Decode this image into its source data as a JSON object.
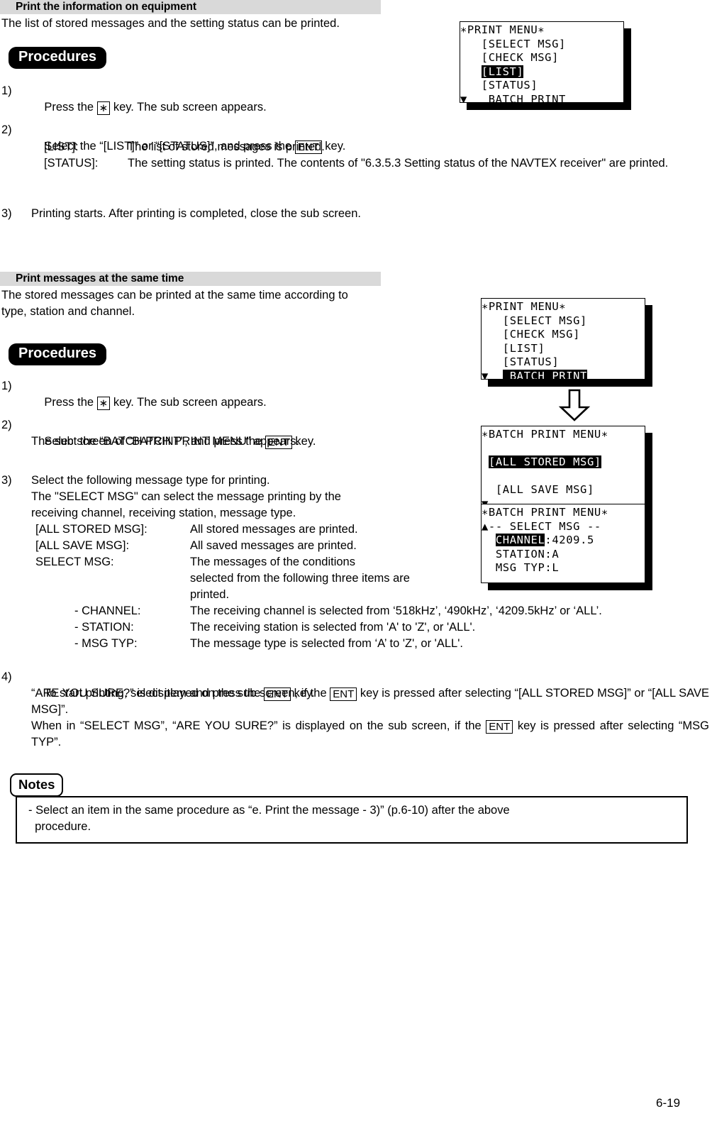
{
  "page": {
    "number": "6-19"
  },
  "sections": [
    {
      "header": "Print the information on equipment",
      "intro": "The list of stored messages and the setting status can be printed.",
      "procedures_label": "Procedures",
      "steps": {
        "s1_num": "1)",
        "s1_a": "Press the",
        "s1_key": "∗",
        "s1_b": "key. The sub screen appears.",
        "s2_num": "2)",
        "s2_a": "Select the “[LIST]” or “[STATUS]”, and press the",
        "s2_key": "ENT",
        "s2_b": "key.",
        "s2_d1_term": "[LIST]:",
        "s2_d1_desc": "The list of stored messages is printed.",
        "s2_d2_term": "[STATUS]:",
        "s2_d2_desc": "The setting status is printed. The contents of \"6.3.5.3 Setting status of the NAVTEX receiver\" are printed.",
        "s3_num": "3)",
        "s3_text": "Printing starts. After printing is completed, close the sub screen."
      }
    },
    {
      "header": "Print messages at the same time",
      "intro_l1": "The stored messages can be printed at the same time according to",
      "intro_l2": "type, station and channel.",
      "procedures_label": "Procedures",
      "steps": {
        "s1_num": "1)",
        "s1_a": "Press the",
        "s1_key": "∗",
        "s1_b": "key. The sub screen appears.",
        "s2_num": "2)",
        "s2_a": "Select the “BATCH PRINT”, and press the",
        "s2_key": "ENT",
        "s2_b": "key.",
        "s2_l2": "The sub screen of “BATCH PRINT MENU” appears.",
        "s3_num": "3)",
        "s3_l1": "Select the following message type for printing.",
        "s3_l2": "The \"SELECT MSG\" can select the message printing by the",
        "s3_l3": "receiving channel, receiving station, message type.",
        "s3_rows": [
          {
            "term": "[ALL STORED MSG]:",
            "desc": "All stored messages are printed."
          },
          {
            "term": "[ALL SAVE MSG]:",
            "desc": "All saved messages are printed."
          },
          {
            "term": "SELECT MSG:",
            "desc": "The messages of the conditions"
          }
        ],
        "s3_cont_l1": "selected from the following three items are",
        "s3_cont_l2": "printed.",
        "s3_sub_rows": [
          {
            "term": "- CHANNEL:",
            "desc": "The receiving channel is selected from ‘518kHz’, ‘490kHz’, ‘4209.5kHz’ or ‘ALL’."
          },
          {
            "term": "- STATION:",
            "desc": "The receiving station is selected from 'A' to 'Z', or 'ALL'."
          },
          {
            "term": "- MSG TYP:",
            "desc": "The message type is selected from ‘A’ to 'Z', or 'ALL'."
          }
        ],
        "s4_num": "4)",
        "s4_a": "To start printing, select item and press the",
        "s4_key": "ENT",
        "s4_b": "key.",
        "s4_p2_a": "“ARE YOU SURE?” is displayed on the sub screen, if the",
        "s4_p2_key": "ENT",
        "s4_p2_b": "key is pressed after selecting “[ALL STORED MSG]” or “[ALL SAVE MSG]”.",
        "s4_p3_a": "When in “SELECT MSG”, “ARE YOU SURE?” is displayed on the sub screen, if the",
        "s4_p3_key": "ENT",
        "s4_p3_b": "key is pressed after selecting “MSG TYP”."
      }
    }
  ],
  "lcd_screens": [
    {
      "id": "print-menu-list",
      "lines": [
        {
          "text": "∗PRINT MENU∗",
          "highlight": false
        },
        {
          "text": "   [SELECT MSG]",
          "highlight": false
        },
        {
          "text": "   [CHECK MSG]",
          "highlight": false
        },
        {
          "text": "   [LIST]",
          "highlight": true,
          "hl_start": 3,
          "hl_len": 6
        },
        {
          "text": "   [STATUS]",
          "highlight": false
        },
        {
          "text": "▼   BATCH PRINT",
          "highlight": false
        }
      ]
    },
    {
      "id": "print-menu-batch",
      "lines": [
        {
          "text": "∗PRINT MENU∗",
          "highlight": false
        },
        {
          "text": "   [SELECT MSG]",
          "highlight": false
        },
        {
          "text": "   [CHECK MSG]",
          "highlight": false
        },
        {
          "text": "   [LIST]",
          "highlight": false
        },
        {
          "text": "   [STATUS]",
          "highlight": false
        },
        {
          "text": "▼   BATCH PRINT",
          "highlight": true,
          "hl_start": 3,
          "hl_len": 12
        }
      ]
    },
    {
      "id": "batch-print-menu-top",
      "lines": [
        {
          "text": "∗BATCH PRINT MENU∗",
          "highlight": false
        },
        {
          "text": "",
          "highlight": false
        },
        {
          "text": " [ALL STORED MSG]",
          "highlight": true,
          "hl_start": 1,
          "hl_len": 16
        },
        {
          "text": "",
          "highlight": false
        },
        {
          "text": "  [ALL SAVE MSG]",
          "highlight": false
        },
        {
          "text": "▼",
          "highlight": false
        }
      ]
    },
    {
      "id": "batch-print-menu-select",
      "lines": [
        {
          "text": "∗BATCH PRINT MENU∗",
          "highlight": false
        },
        {
          "text": "▲-- SELECT MSG --",
          "highlight": false
        },
        {
          "text": "  CHANNEL:4209.5",
          "highlight": true,
          "hl_start": 2,
          "hl_len": 7
        },
        {
          "text": "  STATION:A",
          "highlight": false
        },
        {
          "text": "  MSG TYP:L",
          "highlight": false
        },
        {
          "text": "",
          "highlight": false
        }
      ]
    }
  ],
  "arrow": {
    "name": "down-arrow"
  },
  "notes": {
    "label": "Notes",
    "line1": "- Select an item in the same procedure as “e. Print the message - 3)” (p.6-10) after the above",
    "line2": "  procedure."
  }
}
